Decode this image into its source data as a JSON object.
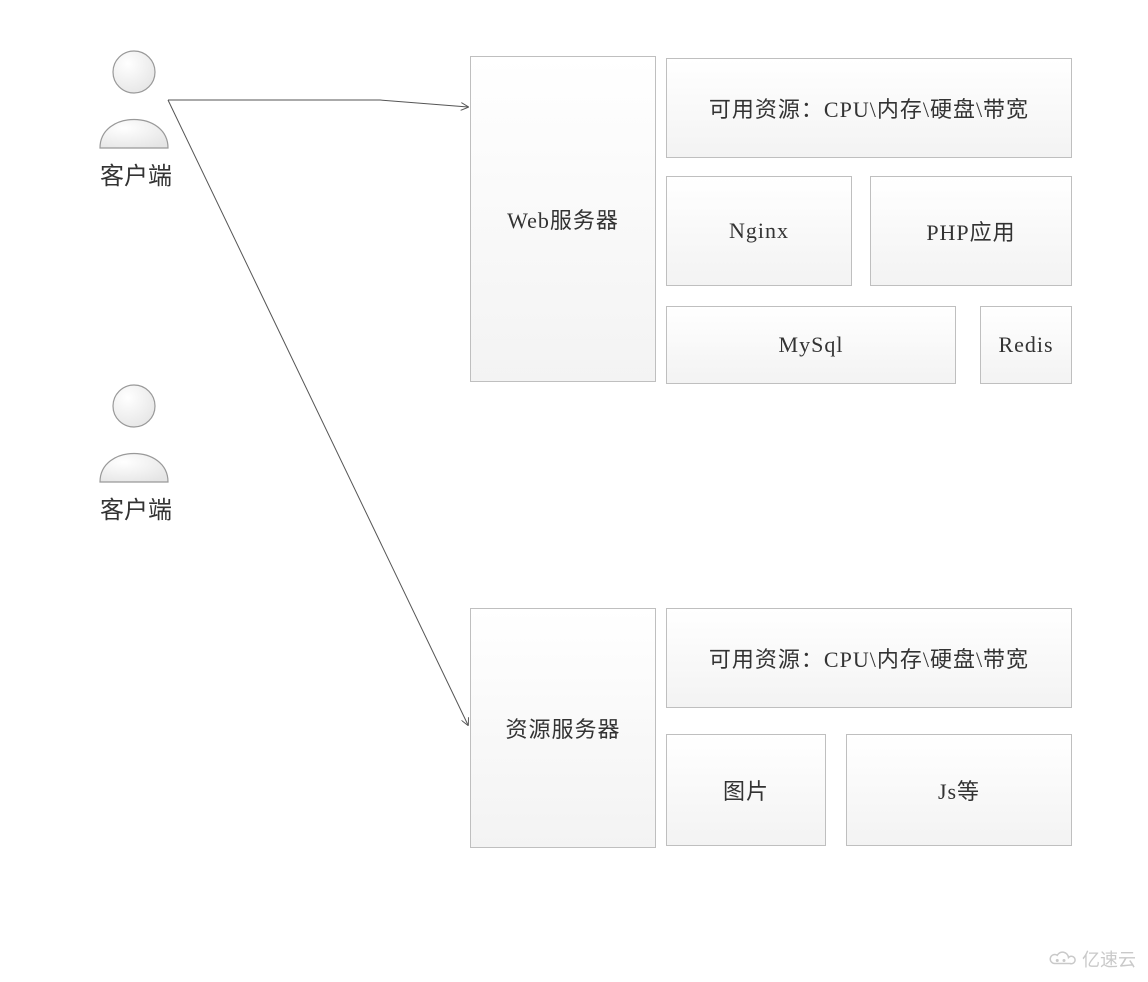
{
  "actors": {
    "client1_label": "客户端",
    "client2_label": "客户端"
  },
  "top_group": {
    "server_label": "Web服务器",
    "resources_label": "可用资源：CPU\\内存\\硬盘\\带宽",
    "nginx_label": "Nginx",
    "php_label": "PHP应用",
    "mysql_label": "MySql",
    "redis_label": "Redis"
  },
  "bottom_group": {
    "server_label": "资源服务器",
    "resources_label": "可用资源：CPU\\内存\\硬盘\\带宽",
    "image_label": "图片",
    "js_label": "Js等"
  },
  "watermark": {
    "text": "亿速云"
  }
}
